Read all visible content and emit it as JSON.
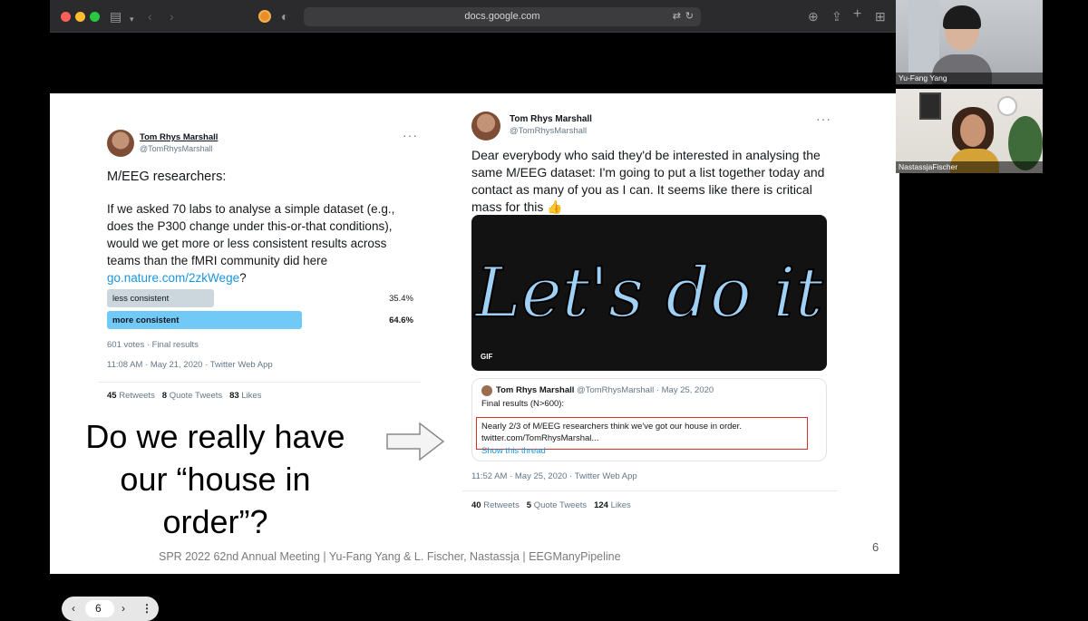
{
  "browser": {
    "url": "docs.google.com"
  },
  "slide": {
    "tweet1": {
      "name": "Tom Rhys Marshall",
      "handle": "@TomRhysMarshall",
      "line1": "M/EEG researchers:",
      "body": "If we asked 70 labs to analyse a simple dataset (e.g., does the P300 change under this-or-that conditions), would we get more or less consistent results across teams than the fMRI community did here",
      "link": "go.nature.com/2zkWege",
      "link_suffix": "?",
      "poll": [
        {
          "label": "less consistent",
          "percent": "35.4%",
          "fraction": 0.354,
          "selected": false
        },
        {
          "label": "more consistent",
          "percent": "64.6%",
          "fraction": 0.646,
          "selected": true
        }
      ],
      "votes": "601 votes · Final results",
      "timestamp": "11:08 AM · May 21, 2020 · Twitter Web App",
      "stats": {
        "retweets_count": "45",
        "retweets_label": "Retweets",
        "quotes_count": "8",
        "quotes_label": "Quote Tweets",
        "likes_count": "83",
        "likes_label": "Likes"
      }
    },
    "tweet2": {
      "name": "Tom Rhys Marshall",
      "handle": "@TomRhysMarshall",
      "body": "Dear everybody who said they'd be interested in analysing the same M/EEG dataset: I'm going to put a list together today and contact as many of you as I can. It seems like there is critical mass for this 👍",
      "gif_text": "Let's do it",
      "gif_badge": "GIF",
      "quote": {
        "name": "Tom Rhys Marshall",
        "handle_date": "@TomRhysMarshall · May 25, 2020",
        "line1": "Final results (N>600):",
        "line2": "Nearly 2/3 of M/EEG researchers think we've got our house in order.",
        "line3": "twitter.com/TomRhysMarshal...",
        "show_thread": "Show this thread"
      },
      "timestamp": "11:52 AM · May 25, 2020 · Twitter Web App",
      "stats": {
        "retweets_count": "40",
        "retweets_label": "Retweets",
        "quotes_count": "5",
        "quotes_label": "Quote Tweets",
        "likes_count": "124",
        "likes_label": "Likes"
      }
    },
    "question": {
      "line1": "Do we really have",
      "line2": "our “house in",
      "line3": "order”?"
    },
    "footer": "SPR 2022 62nd Annual Meeting | Yu-Fang Yang & L. Fischer, Nastassja | EEGManyPipeline",
    "page_number": "6"
  },
  "pager": {
    "current": "6"
  },
  "participants": [
    {
      "name": "Yu-Fang Yang"
    },
    {
      "name": "NastassjaFischer"
    }
  ]
}
